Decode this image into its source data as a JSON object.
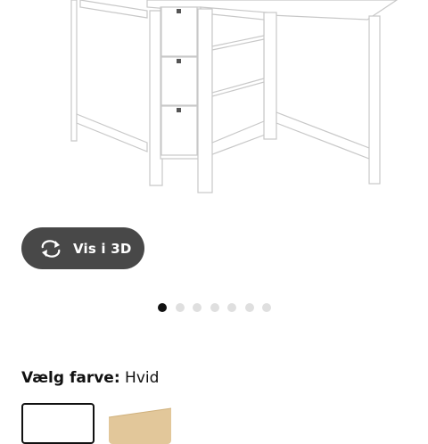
{
  "product": {
    "image_alt": "white gateleg table with drawers",
    "image_icon": "gateleg-table-image"
  },
  "view3d": {
    "label": "Vis i 3D",
    "icon": "rotate-3d-icon"
  },
  "carousel": {
    "count": 7,
    "active": 1
  },
  "color_picker": {
    "label": "Vælg farve:",
    "value": "Hvid",
    "swatches": [
      {
        "name": "Hvid",
        "color": "#ffffff",
        "selected": true
      },
      {
        "name": "Birch",
        "color": "#e2c79a",
        "selected": false
      }
    ]
  }
}
